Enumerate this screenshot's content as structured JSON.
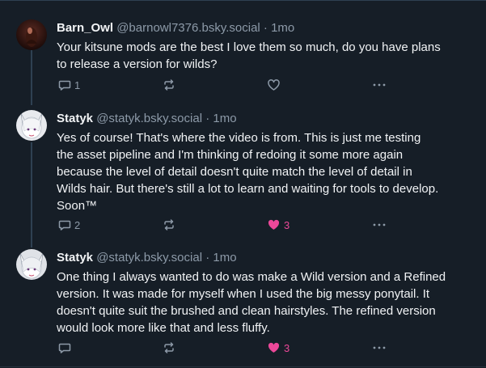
{
  "colors": {
    "background": "#161e27",
    "text": "#f1f3f5",
    "muted": "#8d9aa8",
    "like": "#ec4899",
    "thread_line": "#2e4052"
  },
  "posts": [
    {
      "display_name": "Barn_Owl",
      "handle": "@barnowl7376.bsky.social",
      "separator": "·",
      "time": "1mo",
      "text_lines": [
        "Your kitsune mods are the best I love them so much, do you have plans",
        "to release a version for wilds?"
      ],
      "reply_count": "1",
      "repost_count": "",
      "like_count": "",
      "liked": false,
      "icons": [
        "reply-icon",
        "repost-icon",
        "like-icon",
        "more-icon"
      ]
    },
    {
      "display_name": "Statyk",
      "handle": "@statyk.bsky.social",
      "separator": "·",
      "time": "1mo",
      "text_lines": [
        "Yes of course! That's where the video is from. This is just me testing",
        "the asset pipeline and I'm thinking of redoing it some more again",
        "because the level of detail doesn't quite match the level of detail in",
        "Wilds hair. But there's still a lot to learn and waiting for tools to develop.",
        "Soon™"
      ],
      "reply_count": "2",
      "repost_count": "",
      "like_count": "3",
      "liked": true,
      "icons": [
        "reply-icon",
        "repost-icon",
        "heart-filled-icon",
        "more-icon"
      ]
    },
    {
      "display_name": "Statyk",
      "handle": "@statyk.bsky.social",
      "separator": "·",
      "time": "1mo",
      "text_lines": [
        "One thing I always wanted to do was make a Wild version and a Refined",
        "version. It was made for myself when I used the big messy ponytail. It",
        "doesn't quite suit the brushed and clean hairstyles. The refined version",
        "would look more like that and less fluffy."
      ],
      "reply_count": "",
      "repost_count": "",
      "like_count": "3",
      "liked": true,
      "icons": [
        "reply-icon",
        "repost-icon",
        "heart-filled-icon",
        "more-icon"
      ]
    }
  ]
}
